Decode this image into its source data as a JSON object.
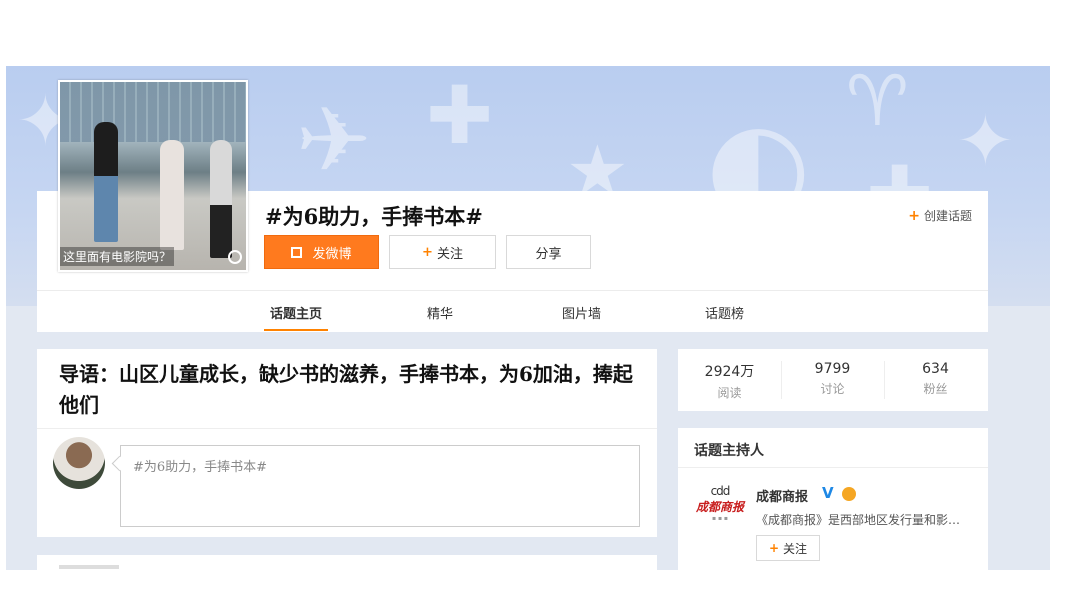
{
  "topic": {
    "title": "#为6助力，手捧书本#",
    "cover_caption": "这里面有电影院吗？",
    "create_label": "创建话题"
  },
  "actions": {
    "post_label": "发微博",
    "follow_label": "关注",
    "share_label": "分享"
  },
  "tabs": [
    {
      "label": "话题主页",
      "active": true
    },
    {
      "label": "精华",
      "active": false
    },
    {
      "label": "图片墙",
      "active": false
    },
    {
      "label": "话题榜",
      "active": false
    }
  ],
  "intro": {
    "text": "导语：山区儿童成长，缺少书的滋养，手捧书本，为6加油，捧起他们"
  },
  "composer": {
    "value": "#为6助力，手捧书本#"
  },
  "stats": [
    {
      "value": "2924万",
      "label": "阅读"
    },
    {
      "value": "9799",
      "label": "讨论"
    },
    {
      "value": "634",
      "label": "粉丝"
    }
  ],
  "host": {
    "section_title": "话题主持人",
    "name": "成都商报",
    "verified_mark": "V",
    "description": "《成都商报》是西部地区发行量和影…",
    "follow_label": "关注",
    "logo_top": "cdd",
    "logo_name": "成都商报"
  },
  "colors": {
    "accent": "#ff8200",
    "post_button": "#ff7a1e",
    "verified": "#1e88e5"
  }
}
